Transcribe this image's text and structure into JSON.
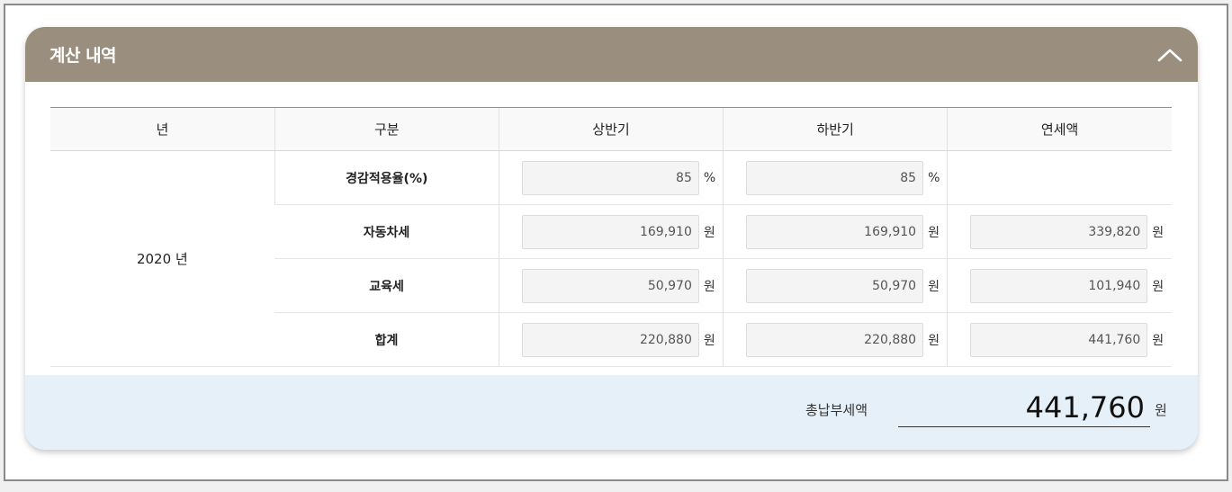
{
  "header": {
    "title": "계산 내역"
  },
  "table": {
    "columns": [
      "년",
      "구분",
      "상반기",
      "하반기",
      "연세액"
    ],
    "year": "2020 년",
    "rows": [
      {
        "label": "경감적용율(%)",
        "first_half": "85",
        "first_unit": "%",
        "second_half": "85",
        "second_unit": "%",
        "annual": "",
        "annual_unit": ""
      },
      {
        "label": "자동차세",
        "first_half": "169,910",
        "first_unit": "원",
        "second_half": "169,910",
        "second_unit": "원",
        "annual": "339,820",
        "annual_unit": "원"
      },
      {
        "label": "교육세",
        "first_half": "50,970",
        "first_unit": "원",
        "second_half": "50,970",
        "second_unit": "원",
        "annual": "101,940",
        "annual_unit": "원"
      },
      {
        "label": "합계",
        "first_half": "220,880",
        "first_unit": "원",
        "second_half": "220,880",
        "second_unit": "원",
        "annual": "441,760",
        "annual_unit": "원"
      }
    ]
  },
  "total": {
    "label": "총납부세액",
    "value": "441,760",
    "unit": "원"
  },
  "icons": {
    "collapse": "chevron-up-icon"
  },
  "colors": {
    "header_bg": "#9a8f7e",
    "footer_bg": "#e5f0f9"
  }
}
